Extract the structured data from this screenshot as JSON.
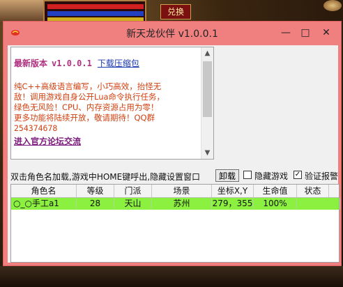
{
  "game": {
    "swap_label": "兑换"
  },
  "window": {
    "title": "新天龙伙伴 v1.0.0.1",
    "minimize_label": "—",
    "maximize_label": "□",
    "close_label": "✕"
  },
  "info": {
    "version_label": "最新版本",
    "version_value": "v1.0.0.1",
    "download_link": "下载压缩包",
    "desc_line1": "纯C++高级语言编写，小巧高效，抬怪无",
    "desc_line2": "敌！调用游戏自身公开Lua命令执行任务，",
    "desc_line3": "绿色无风险！CPU、内存资源占用为零！",
    "desc_line4": "更多功能将陆续开放，敬请期待！QQ群",
    "desc_line5": "254374678",
    "forum_link": "进入官方论坛交流"
  },
  "controls": {
    "hint": "双击角色名加载,游戏中HOME键呼出,隐藏设置窗口",
    "unload_button": "卸载",
    "hide_game_label": "隐藏游戏",
    "hide_game_checked": false,
    "verify_alarm_label": "验证报警",
    "verify_alarm_checked": true
  },
  "table": {
    "columns": [
      "角色名",
      "等级",
      "门派",
      "场景",
      "坐标X,Y",
      "生命值",
      "状态"
    ],
    "rows": [
      {
        "name": "○_○手工a1",
        "level": "28",
        "sect": "天山",
        "scene": "苏州",
        "coords": "279，355",
        "hp": "100%",
        "status": ""
      }
    ],
    "row_highlight_color": "#8cf040"
  },
  "colors": {
    "window_bg": "#f08080",
    "version_accent": "#b03080",
    "desc_text": "#d04010",
    "link": "#1a3ab0"
  }
}
